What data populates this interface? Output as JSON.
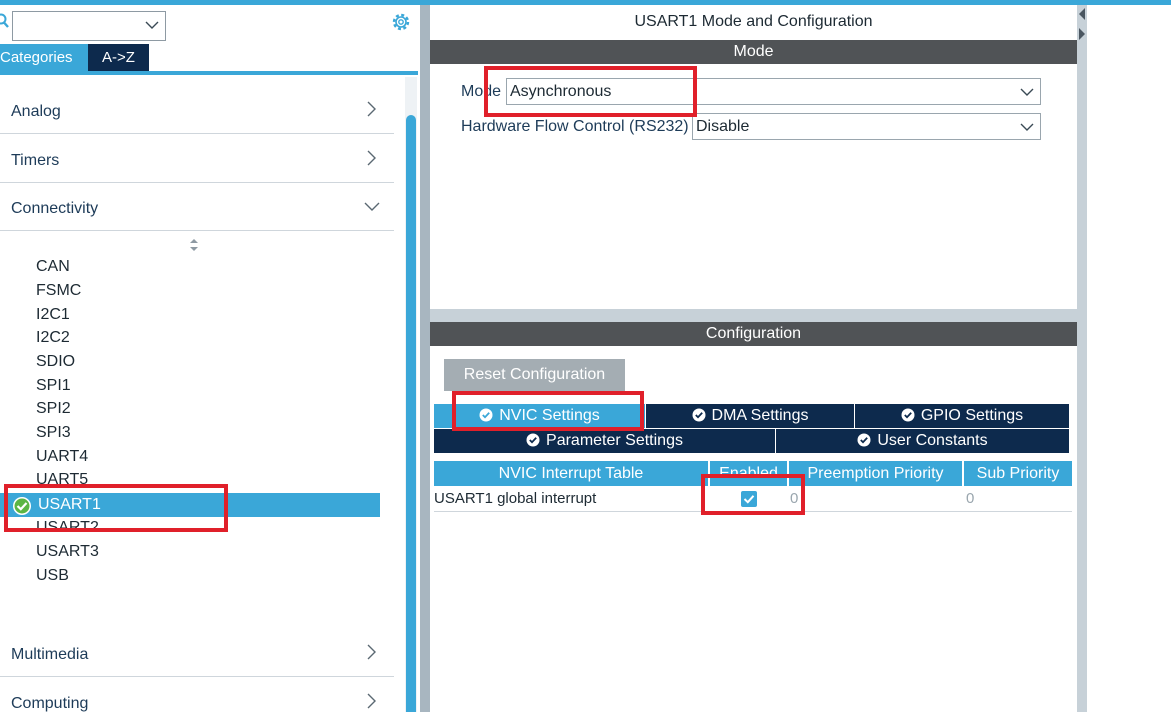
{
  "sidebar": {
    "search": {
      "value": ""
    },
    "tabs": [
      {
        "label": "Categories",
        "active": true
      },
      {
        "label": "A->Z",
        "active": false
      }
    ],
    "sections": [
      {
        "label": "Analog",
        "expanded": false
      },
      {
        "label": "Timers",
        "expanded": false
      },
      {
        "label": "Connectivity",
        "expanded": true
      },
      {
        "label": "Multimedia",
        "expanded": false
      },
      {
        "label": "Computing",
        "expanded": false
      }
    ],
    "connectivity_items": [
      "CAN",
      "FSMC",
      "I2C1",
      "I2C2",
      "SDIO",
      "SPI1",
      "SPI2",
      "SPI3",
      "UART4",
      "UART5",
      "USART1",
      "USART2",
      "USART3",
      "USB"
    ],
    "selected_item": "USART1"
  },
  "main": {
    "title": "USART1 Mode and Configuration",
    "mode_bar": "Mode",
    "mode_label": "Mode",
    "mode_value": "Asynchronous",
    "flow_label": "Hardware Flow Control (RS232)",
    "flow_value": "Disable",
    "config_bar": "Configuration",
    "reset_label": "Reset Configuration",
    "tabs": [
      {
        "label": "NVIC Settings",
        "active": true
      },
      {
        "label": "DMA Settings",
        "active": false
      },
      {
        "label": "GPIO Settings",
        "active": false
      },
      {
        "label": "Parameter Settings",
        "active": false
      },
      {
        "label": "User Constants",
        "active": false
      }
    ],
    "table": {
      "headers": [
        "NVIC Interrupt Table",
        "Enabled",
        "Preemption Priority",
        "Sub Priority"
      ],
      "rows": [
        {
          "name": "USART1 global interrupt",
          "enabled": true,
          "preemption": "0",
          "sub": "0"
        }
      ]
    }
  },
  "colors": {
    "accent": "#3aa7d8",
    "navy": "#0d2a4d",
    "bar": "#505356",
    "highlight": "#e0202a"
  }
}
